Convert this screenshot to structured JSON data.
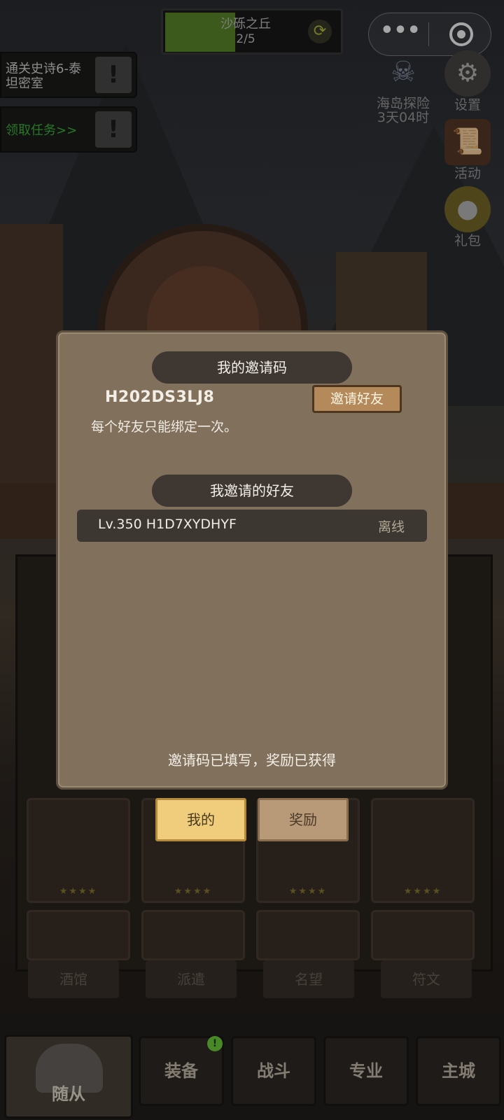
{
  "stage": {
    "name": "沙砾之丘",
    "progress": "2/5"
  },
  "capsule": {
    "more_label": "•••"
  },
  "quests": [
    {
      "text": "通关史诗6-泰坦密室",
      "color": "#d8d8d8"
    },
    {
      "text": "领取任务>>",
      "color": "#3db83d"
    }
  ],
  "side_buttons": {
    "island": {
      "label": "海岛探险",
      "timer": "3天04时"
    },
    "settings": {
      "label": "设置"
    },
    "events": {
      "label": "活动"
    },
    "gift": {
      "label": "礼包"
    }
  },
  "modal": {
    "my_code_title": "我的邀请码",
    "invite_code": "H202DS3LJ8",
    "invite_button": "邀请好友",
    "bind_note": "每个好友只能绑定一次。",
    "friends_title": "我邀请的好友",
    "friends": [
      {
        "name": "Lv.350 H1D7XYDHYF",
        "status": "离线"
      }
    ],
    "filled_note": "邀请码已填写，奖励已获得",
    "tabs": {
      "mine": "我的",
      "reward": "奖励"
    }
  },
  "roster_tabs": [
    "酒馆",
    "派遣",
    "名望",
    "符文"
  ],
  "bottom_nav": {
    "followers": "随从",
    "equipment": "装备",
    "battle": "战斗",
    "profession": "专业",
    "main_city": "主城",
    "badge": "!"
  },
  "colors": {
    "modal_bg": "#80705c",
    "ribbon_bg": "#3f3832",
    "tab_active": "#efcd7c",
    "tab_inactive": "#b89a78",
    "stage_fill": "#5b8a2a"
  }
}
